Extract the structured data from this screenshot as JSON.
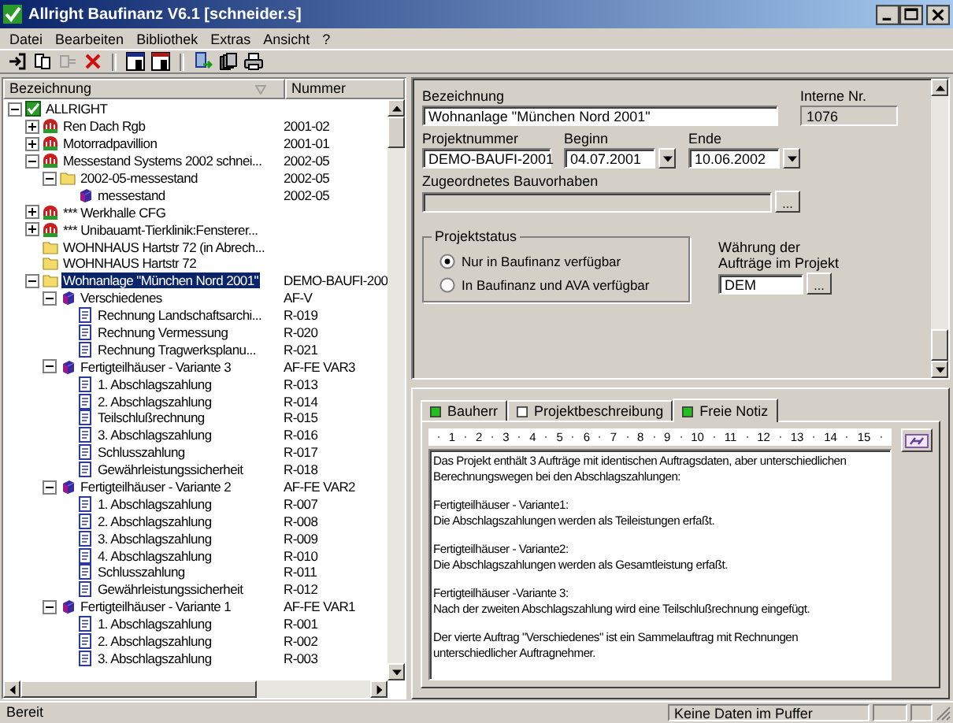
{
  "window": {
    "title": "Allright Baufinanz V6.1 [schneider.s]"
  },
  "menu": [
    "Datei",
    "Bearbeiten",
    "Bibliothek",
    "Extras",
    "Ansicht",
    "?"
  ],
  "tree": {
    "columns": [
      "Bezeichnung",
      "Nummer"
    ],
    "nodes": [
      {
        "label": "ALLRIGHT",
        "kind": "root",
        "expanded": true,
        "selected": false,
        "children": [
          {
            "label": "Ren Dach Rgb",
            "number": "2001-02",
            "kind": "company",
            "expanded": false,
            "selected": false
          },
          {
            "label": "Motorradpavillion",
            "number": "2001-01",
            "kind": "company",
            "expanded": false,
            "selected": false
          },
          {
            "label": "Messestand Systems 2002 schnei...",
            "number": "2002-05",
            "kind": "company",
            "expanded": true,
            "selected": false,
            "children": [
              {
                "label": "2002-05-messestand",
                "number": "2002-05",
                "kind": "folder",
                "expanded": true,
                "selected": false,
                "children": [
                  {
                    "label": "messestand",
                    "number": "2002-05",
                    "kind": "cube",
                    "selected": false
                  }
                ]
              }
            ]
          },
          {
            "label": "*** Werkhalle CFG",
            "kind": "company",
            "expanded": false,
            "selected": false
          },
          {
            "label": "*** Unibauamt-Tierklinik:Fensterer...",
            "kind": "company",
            "expanded": false,
            "selected": false
          },
          {
            "label": "WOHNHAUS Hartstr 72 (in Abrech...",
            "kind": "folder",
            "selected": false
          },
          {
            "label": "WOHNHAUS Hartstr 72",
            "kind": "folder",
            "selected": false
          },
          {
            "label": "Wohnanlage \"München Nord 2001\"",
            "number": "DEMO-BAUFI-200",
            "kind": "folder",
            "expanded": true,
            "selected": true,
            "children": [
              {
                "label": "Verschiedenes",
                "number": "AF-V",
                "kind": "cube",
                "expanded": true,
                "selected": false,
                "children": [
                  {
                    "label": "Rechnung Landschaftsarchi...",
                    "number": "R-019",
                    "kind": "document",
                    "selected": false
                  },
                  {
                    "label": "Rechnung Vermessung",
                    "number": "R-020",
                    "kind": "document",
                    "selected": false
                  },
                  {
                    "label": "Rechnung Tragwerksplanu...",
                    "number": "R-021",
                    "kind": "document",
                    "selected": false
                  }
                ]
              },
              {
                "label": "Fertigteilhäuser - Variante 3",
                "number": "AF-FE VAR3",
                "kind": "cube",
                "expanded": true,
                "selected": false,
                "children": [
                  {
                    "label": "1. Abschlagszahlung",
                    "number": "R-013",
                    "kind": "document",
                    "selected": false
                  },
                  {
                    "label": "2. Abschlagszahlung",
                    "number": "R-014",
                    "kind": "document",
                    "selected": false
                  },
                  {
                    "label": "Teilschlußrechnung",
                    "number": "R-015",
                    "kind": "document",
                    "selected": false
                  },
                  {
                    "label": "3. Abschlagszahlung",
                    "number": "R-016",
                    "kind": "document",
                    "selected": false
                  },
                  {
                    "label": "Schlusszahlung",
                    "number": "R-017",
                    "kind": "document",
                    "selected": false
                  },
                  {
                    "label": "Gewährleistungssicherheit",
                    "number": "R-018",
                    "kind": "document",
                    "selected": false
                  }
                ]
              },
              {
                "label": "Fertigteilhäuser - Variante 2",
                "number": "AF-FE VAR2",
                "kind": "cube",
                "expanded": true,
                "selected": false,
                "children": [
                  {
                    "label": "1. Abschlagszahlung",
                    "number": "R-007",
                    "kind": "document",
                    "selected": false
                  },
                  {
                    "label": "2. Abschlagszahlung",
                    "number": "R-008",
                    "kind": "document",
                    "selected": false
                  },
                  {
                    "label": "3. Abschlagszahlung",
                    "number": "R-009",
                    "kind": "document",
                    "selected": false
                  },
                  {
                    "label": "4. Abschlagszahlung",
                    "number": "R-010",
                    "kind": "document",
                    "selected": false
                  },
                  {
                    "label": "Schlusszahlung",
                    "number": "R-011",
                    "kind": "document",
                    "selected": false
                  },
                  {
                    "label": "Gewährleistungssicherheit",
                    "number": "R-012",
                    "kind": "document",
                    "selected": false
                  }
                ]
              },
              {
                "label": "Fertigteilhäuser - Variante 1",
                "number": "AF-FE VAR1",
                "kind": "cube",
                "expanded": true,
                "selected": false,
                "children": [
                  {
                    "label": "1. Abschlagszahlung",
                    "number": "R-001",
                    "kind": "document",
                    "selected": false
                  },
                  {
                    "label": "2. Abschlagszahlung",
                    "number": "R-002",
                    "kind": "document",
                    "selected": false
                  },
                  {
                    "label": "3. Abschlagszahlung",
                    "number": "R-003",
                    "kind": "document",
                    "selected": false
                  }
                ]
              }
            ]
          }
        ]
      }
    ]
  },
  "form": {
    "name": {
      "label": "Bezeichnung",
      "value": "Wohnanlage \"München Nord 2001\""
    },
    "internal_no": {
      "label": "Interne Nr.",
      "value": "1076"
    },
    "project_no": {
      "label": "Projektnummer",
      "value": "DEMO-BAUFI-2001"
    },
    "start": {
      "label": "Beginn",
      "value": "04.07.2001"
    },
    "end": {
      "label": "Ende",
      "value": "10.06.2002"
    },
    "building_project": {
      "label": "Zugeordnetes Bauvorhaben",
      "disabled": true,
      "button": "..."
    },
    "status": {
      "label": "Projektstatus",
      "options": [
        {
          "label": "Nur in Baufinanz verfügbar",
          "selected": true
        },
        {
          "label": "In Baufinanz und AVA verfügbar",
          "selected": false
        }
      ]
    },
    "currency": {
      "label_lines": [
        "Währung der",
        "Aufträge im Projekt"
      ],
      "value": "DEM",
      "button": "..."
    }
  },
  "notes": {
    "tabs": [
      {
        "label": "Bauherr",
        "has_content": true,
        "selected": false
      },
      {
        "label": "Projektbeschreibung",
        "has_content": false,
        "selected": false
      },
      {
        "label": "Freie Notiz",
        "has_content": true,
        "selected": true
      }
    ],
    "ruler": [
      "1",
      "2",
      "3",
      "4",
      "5",
      "6",
      "7",
      "8",
      "9",
      "10",
      "11",
      "12",
      "13",
      "14",
      "15"
    ],
    "paragraphs": [
      [
        "Das Projekt enthält 3 Aufträge mit identischen Auftragsdaten, aber unterschiedlichen",
        "Berechnungswegen bei den Abschlagszahlungen:"
      ],
      [
        "Fertigteilhäuser - Variante1:",
        "Die Abschlagszahlungen werden als Teileistungen erfaßt."
      ],
      [
        "Fertigteilhäuser - Variante2:",
        "Die Abschlagszahlungen werden als Gesamtleistung erfaßt."
      ],
      [
        "Fertigteilhäuser -Variante 3:",
        "Nach der zweiten Abschlagszahlung wird eine Teilschlußrechnung eingefügt."
      ],
      [
        "Der vierte Auftrag \"Verschiedenes\" ist ein Sammelauftrag mit Rechnungen",
        "unterschiedlicher Auftragnehmer."
      ]
    ]
  },
  "status_bar": {
    "message": "Bereit",
    "buffer": "Keine Daten im Puffer"
  }
}
